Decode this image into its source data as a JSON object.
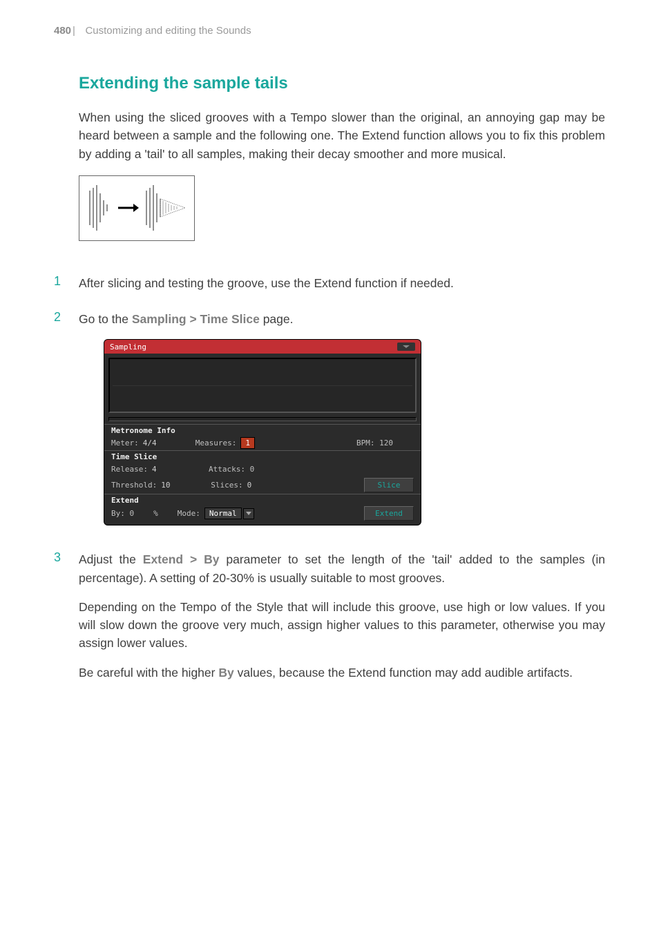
{
  "header": {
    "page_number": "480",
    "separator": "|",
    "chapter": "Customizing and editing the Sounds"
  },
  "heading": "Extending the sample tails",
  "intro": "When using the sliced grooves with a Tempo slower than the original, an annoying gap may be heard between a sample and the following one. The Extend function allows you to fix this problem by adding a 'tail' to all samples, making their decay smoother and more musical.",
  "steps": {
    "s1": {
      "num": "1",
      "text": "After slicing and testing the groove, use the Extend function if needed."
    },
    "s2": {
      "num": "2",
      "pre": "Go to the ",
      "path": "Sampling > Time Slice",
      "post": " page."
    },
    "s3": {
      "num": "3",
      "p1_pre": "Adjust the ",
      "p1_path": "Extend > By",
      "p1_post": " parameter to set the length of the 'tail' added to the samples (in percentage). A setting of 20-30% is usually suitable to most grooves.",
      "p2": "Depending on the Tempo of the Style that will include this groove, use high or low values. If you will slow down the groove very much, assign higher values to this parameter, otherwise you may assign lower values.",
      "p3_pre": "Be careful with the higher ",
      "p3_key": "By",
      "p3_post": " values, because the Extend function may add audible artifacts."
    }
  },
  "device": {
    "title": "Sampling",
    "metronome": {
      "heading": "Metronome Info",
      "meter_label": "Meter:",
      "meter_value": "4/4",
      "measures_label": "Measures:",
      "measures_value": "1",
      "bpm_label": "BPM: 120"
    },
    "timeslice": {
      "heading": "Time Slice",
      "release_label": "Release:",
      "release_value": "4",
      "attacks_label": "Attacks: 0",
      "threshold_label": "Threshold:",
      "threshold_value": "10",
      "slices_label": "Slices:",
      "slices_value": "0",
      "slice_btn": "Slice"
    },
    "extend": {
      "heading": "Extend",
      "by_label": "By: 0",
      "by_unit": "%",
      "mode_label": "Mode:",
      "mode_value": "Normal",
      "extend_btn": "Extend"
    }
  }
}
